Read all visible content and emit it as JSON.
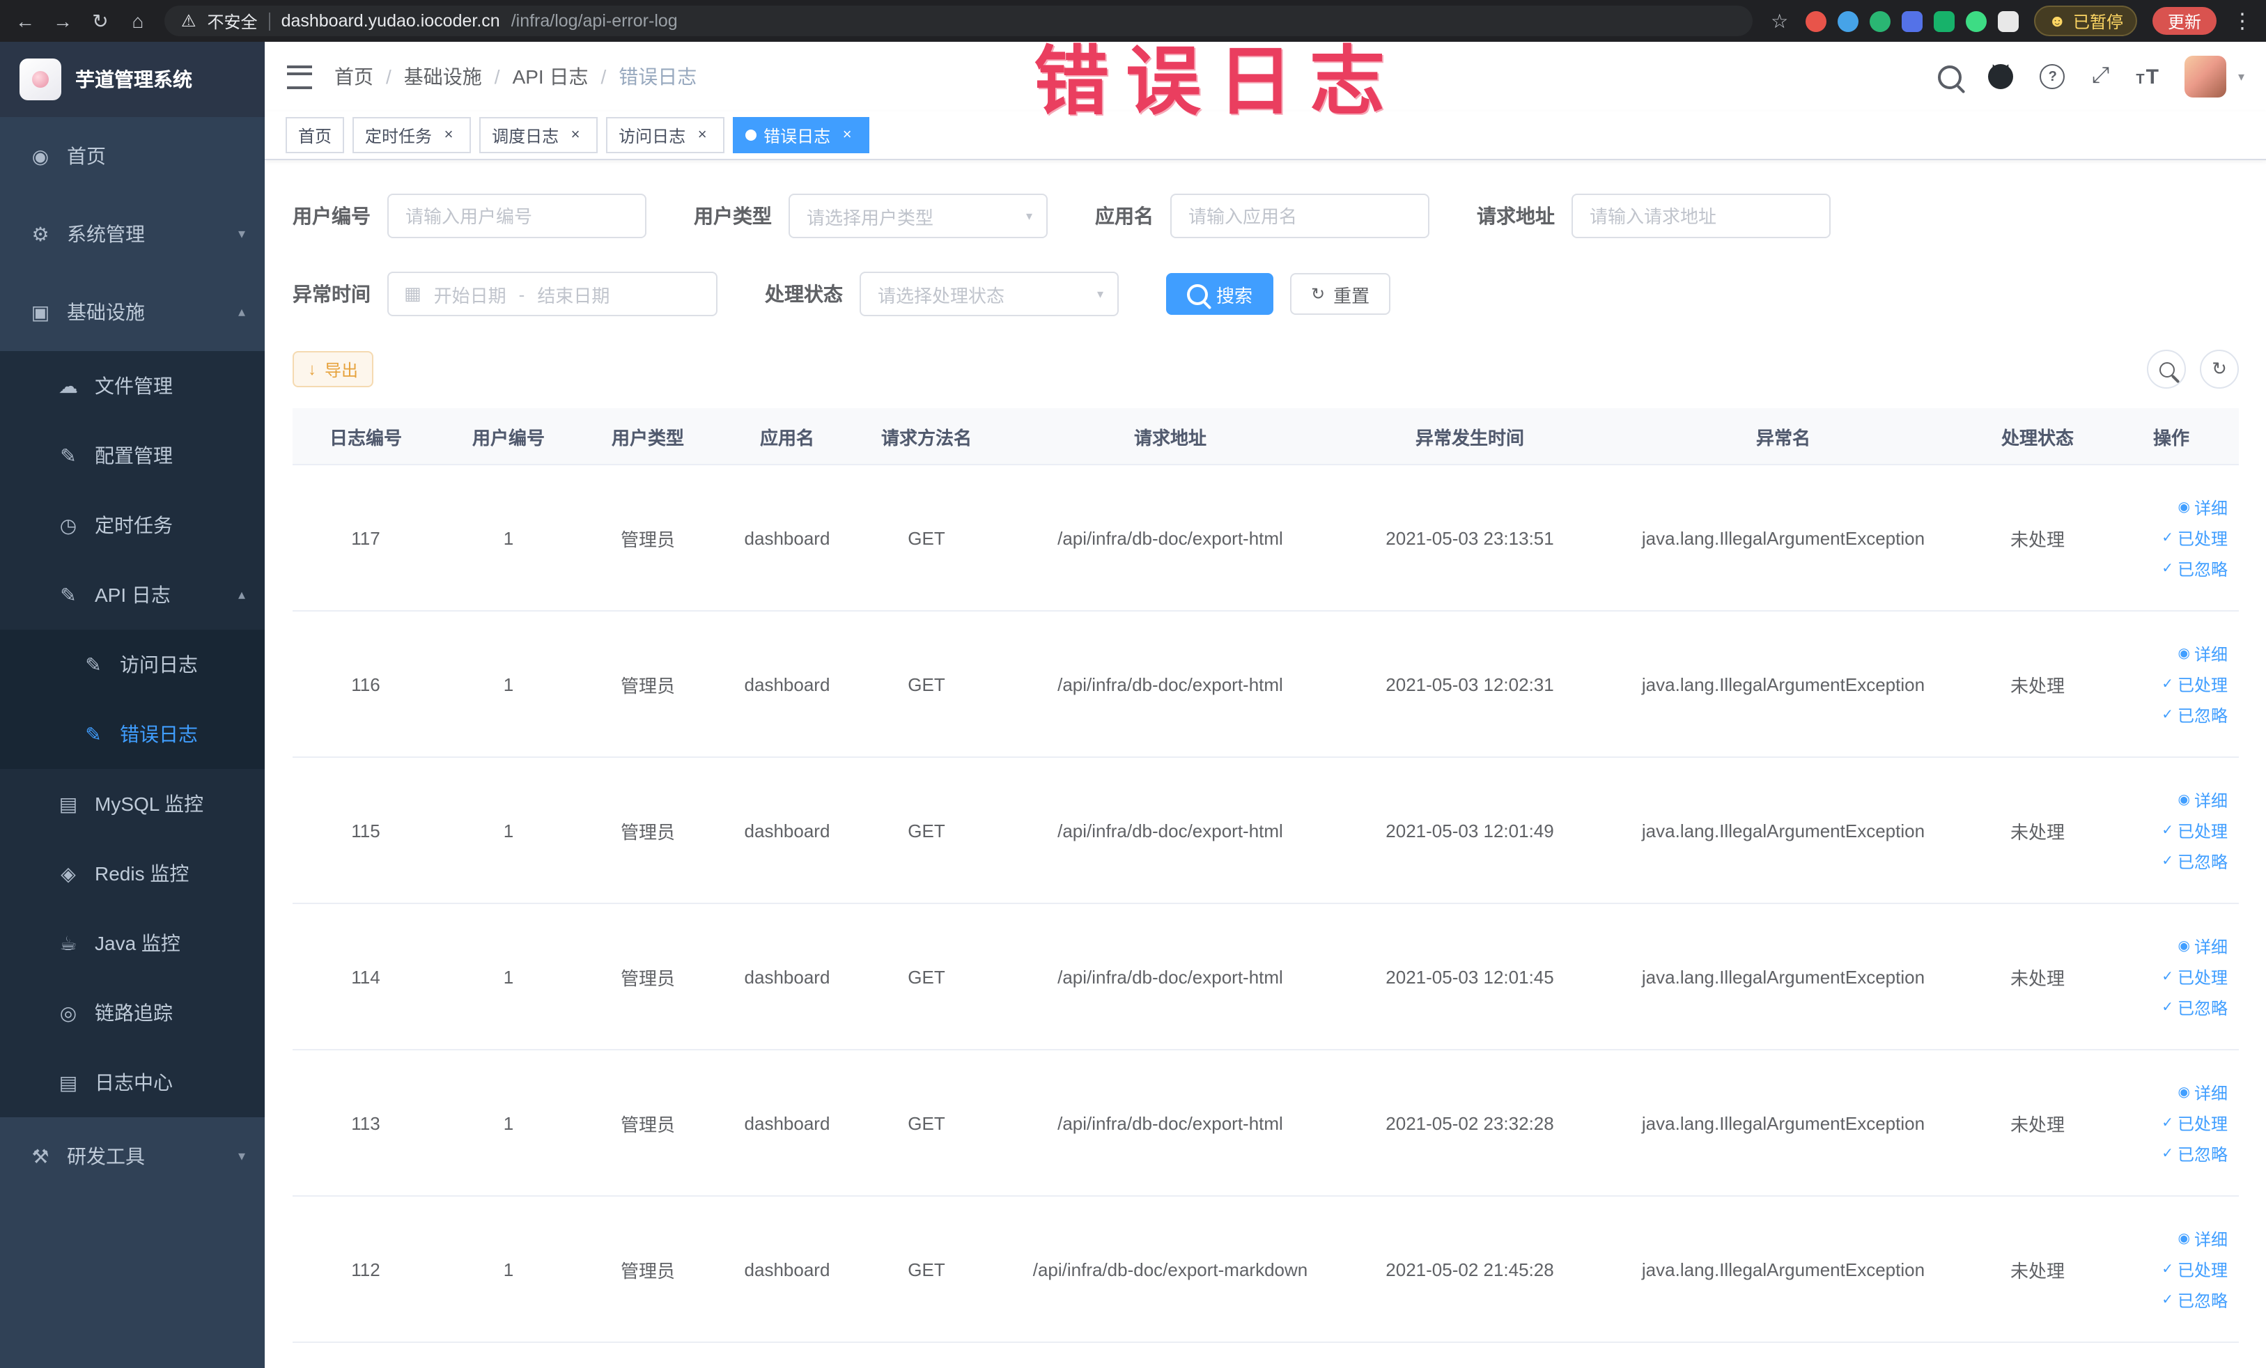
{
  "colors": {
    "accent": "#409eff",
    "sidebar_bg": "#304156",
    "warning": "#e6a23c",
    "annotation": "#ea3e5f"
  },
  "browser": {
    "security_warning": "不安全",
    "url_domain": "dashboard.yudao.iocoder.cn",
    "url_path": "/infra/log/api-error-log",
    "profile_badge": "已暂停",
    "update_button": "更新"
  },
  "annotation": {
    "text": "错误日志"
  },
  "sidebar": {
    "logo_title": "芋道管理系统",
    "home": "首页",
    "system_mgmt": "系统管理",
    "infrastructure": "基础设施",
    "file_mgmt": "文件管理",
    "config_mgmt": "配置管理",
    "scheduled_jobs": "定时任务",
    "api_logs": "API 日志",
    "access_log": "访问日志",
    "error_log": "错误日志",
    "mysql_monitor": "MySQL 监控",
    "redis_monitor": "Redis 监控",
    "java_monitor": "Java 监控",
    "trace": "链路追踪",
    "log_center": "日志中心",
    "dev_tools": "研发工具"
  },
  "breadcrumb": [
    "首页",
    "基础设施",
    "API 日志",
    "错误日志"
  ],
  "breadcrumb_separator": "/",
  "tabs": [
    {
      "label": "首页",
      "active": false,
      "closable": false
    },
    {
      "label": "定时任务",
      "active": false,
      "closable": true
    },
    {
      "label": "调度日志",
      "active": false,
      "closable": true
    },
    {
      "label": "访问日志",
      "active": false,
      "closable": true
    },
    {
      "label": "错误日志",
      "active": true,
      "closable": true
    }
  ],
  "filters": {
    "user_id": {
      "label": "用户编号",
      "placeholder": "请输入用户编号",
      "value": ""
    },
    "user_type": {
      "label": "用户类型",
      "placeholder": "请选择用户类型"
    },
    "app_name": {
      "label": "应用名",
      "placeholder": "请输入应用名",
      "value": ""
    },
    "request_url": {
      "label": "请求地址",
      "placeholder": "请输入请求地址",
      "value": ""
    },
    "exception_time": {
      "label": "异常时间",
      "start": "开始日期",
      "separator": "-",
      "end": "结束日期"
    },
    "status": {
      "label": "处理状态",
      "placeholder": "请选择处理状态"
    },
    "search_label": "搜索",
    "reset_label": "重置"
  },
  "toolbar": {
    "export_label": "导出"
  },
  "table": {
    "columns": [
      "日志编号",
      "用户编号",
      "用户类型",
      "应用名",
      "请求方法名",
      "请求地址",
      "异常发生时间",
      "异常名",
      "处理状态",
      "操作"
    ],
    "action_labels": [
      "详细",
      "已处理",
      "已忽略"
    ],
    "rows": [
      {
        "id": "117",
        "user_id": "1",
        "user_type": "管理员",
        "app": "dashboard",
        "method": "GET",
        "url": "/api/infra/db-doc/export-html",
        "time": "2021-05-03 23:13:51",
        "exception": "java.lang.IllegalArgumentException",
        "status": "未处理"
      },
      {
        "id": "116",
        "user_id": "1",
        "user_type": "管理员",
        "app": "dashboard",
        "method": "GET",
        "url": "/api/infra/db-doc/export-html",
        "time": "2021-05-03 12:02:31",
        "exception": "java.lang.IllegalArgumentException",
        "status": "未处理"
      },
      {
        "id": "115",
        "user_id": "1",
        "user_type": "管理员",
        "app": "dashboard",
        "method": "GET",
        "url": "/api/infra/db-doc/export-html",
        "time": "2021-05-03 12:01:49",
        "exception": "java.lang.IllegalArgumentException",
        "status": "未处理"
      },
      {
        "id": "114",
        "user_id": "1",
        "user_type": "管理员",
        "app": "dashboard",
        "method": "GET",
        "url": "/api/infra/db-doc/export-html",
        "time": "2021-05-03 12:01:45",
        "exception": "java.lang.IllegalArgumentException",
        "status": "未处理"
      },
      {
        "id": "113",
        "user_id": "1",
        "user_type": "管理员",
        "app": "dashboard",
        "method": "GET",
        "url": "/api/infra/db-doc/export-html",
        "time": "2021-05-02 23:32:28",
        "exception": "java.lang.IllegalArgumentException",
        "status": "未处理"
      },
      {
        "id": "112",
        "user_id": "1",
        "user_type": "管理员",
        "app": "dashboard",
        "method": "GET",
        "url": "/api/infra/db-doc/export-markdown",
        "time": "2021-05-02 21:45:28",
        "exception": "java.lang.IllegalArgumentException",
        "status": "未处理"
      }
    ]
  },
  "icons": {
    "back": "←",
    "forward": "→",
    "reload": "↻",
    "home": "⌂",
    "warning": "⚠",
    "star": "☆",
    "kebab": "⋮",
    "smiley": "☻",
    "close": "×",
    "chev_down": "▾",
    "chev_up": "▴",
    "caret_down": "▾",
    "calendar": "▦",
    "fullscreen": "⤢",
    "question": "?",
    "refresh": "↻",
    "download": "↓",
    "eye": "◉",
    "check": "✓",
    "t_large": "T",
    "t_small": "T",
    "menu_home": "◉",
    "menu_system": "⚙",
    "menu_infra": "▣",
    "menu_file": "☁",
    "menu_config": "✎",
    "menu_job": "◷",
    "menu_api": "✎",
    "menu_access": "✎",
    "menu_error": "✎",
    "menu_mysql": "▤",
    "menu_redis": "◈",
    "menu_java": "☕",
    "menu_trace": "◎",
    "menu_logcenter": "▤",
    "menu_dev": "⚒"
  }
}
